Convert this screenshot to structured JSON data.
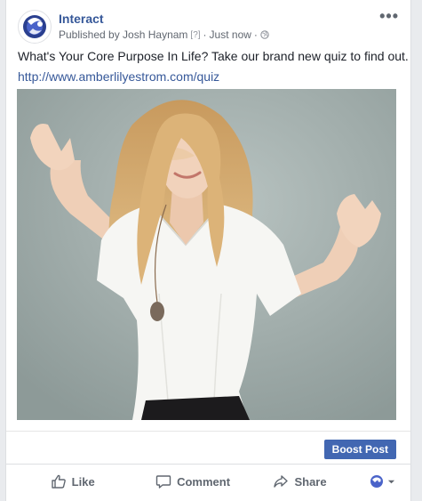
{
  "post": {
    "page_name": "Interact",
    "published_by": "Published by Josh Haynam",
    "help_marker": "[?]",
    "separator": "·",
    "timestamp": "Just now",
    "more_label": "•••",
    "text": "What's Your Core Purpose In Life? Take our brand new quiz to find out.",
    "link": "http://www.amberlilyestrom.com/quiz",
    "avatar_icon": "interact-logo-icon",
    "privacy_icon": "globe-icon",
    "photo_subject": "woman-in-white-blouse-photo"
  },
  "promote": {
    "boost_label": "Boost Post"
  },
  "actions": {
    "like_label": "Like",
    "comment_label": "Comment",
    "share_label": "Share"
  },
  "colors": {
    "link_blue": "#365899",
    "button_blue": "#4267b2",
    "meta_gray": "#616770",
    "background": "#e9ebee"
  }
}
